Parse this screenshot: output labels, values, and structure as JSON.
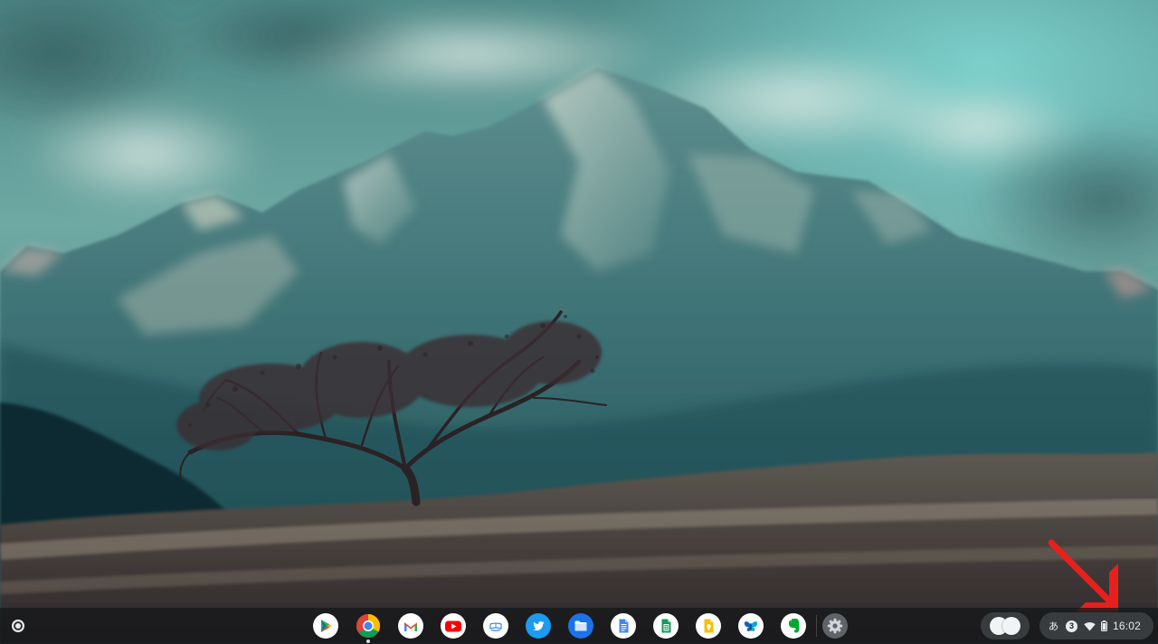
{
  "shelf": {
    "apps": [
      {
        "name": "play-store-icon",
        "running": false
      },
      {
        "name": "chrome-icon",
        "running": true
      },
      {
        "name": "gmail-icon",
        "running": false
      },
      {
        "name": "youtube-icon",
        "running": false
      },
      {
        "name": "kindle-icon",
        "running": false
      },
      {
        "name": "twitter-icon",
        "running": false
      },
      {
        "name": "files-icon",
        "running": false
      },
      {
        "name": "docs-icon",
        "running": false
      },
      {
        "name": "sheets-icon",
        "running": false
      },
      {
        "name": "keep-icon",
        "running": false
      },
      {
        "name": "butterfly-icon",
        "running": false
      },
      {
        "name": "evernote-icon",
        "running": false
      },
      {
        "name": "settings-icon",
        "running": false
      }
    ]
  },
  "status": {
    "ime": "あ",
    "notification_count": "3",
    "time": "16:02"
  },
  "colors": {
    "shelf": "#16181a",
    "pill": "#3c4043",
    "annotation_arrow": "#e8201c"
  }
}
